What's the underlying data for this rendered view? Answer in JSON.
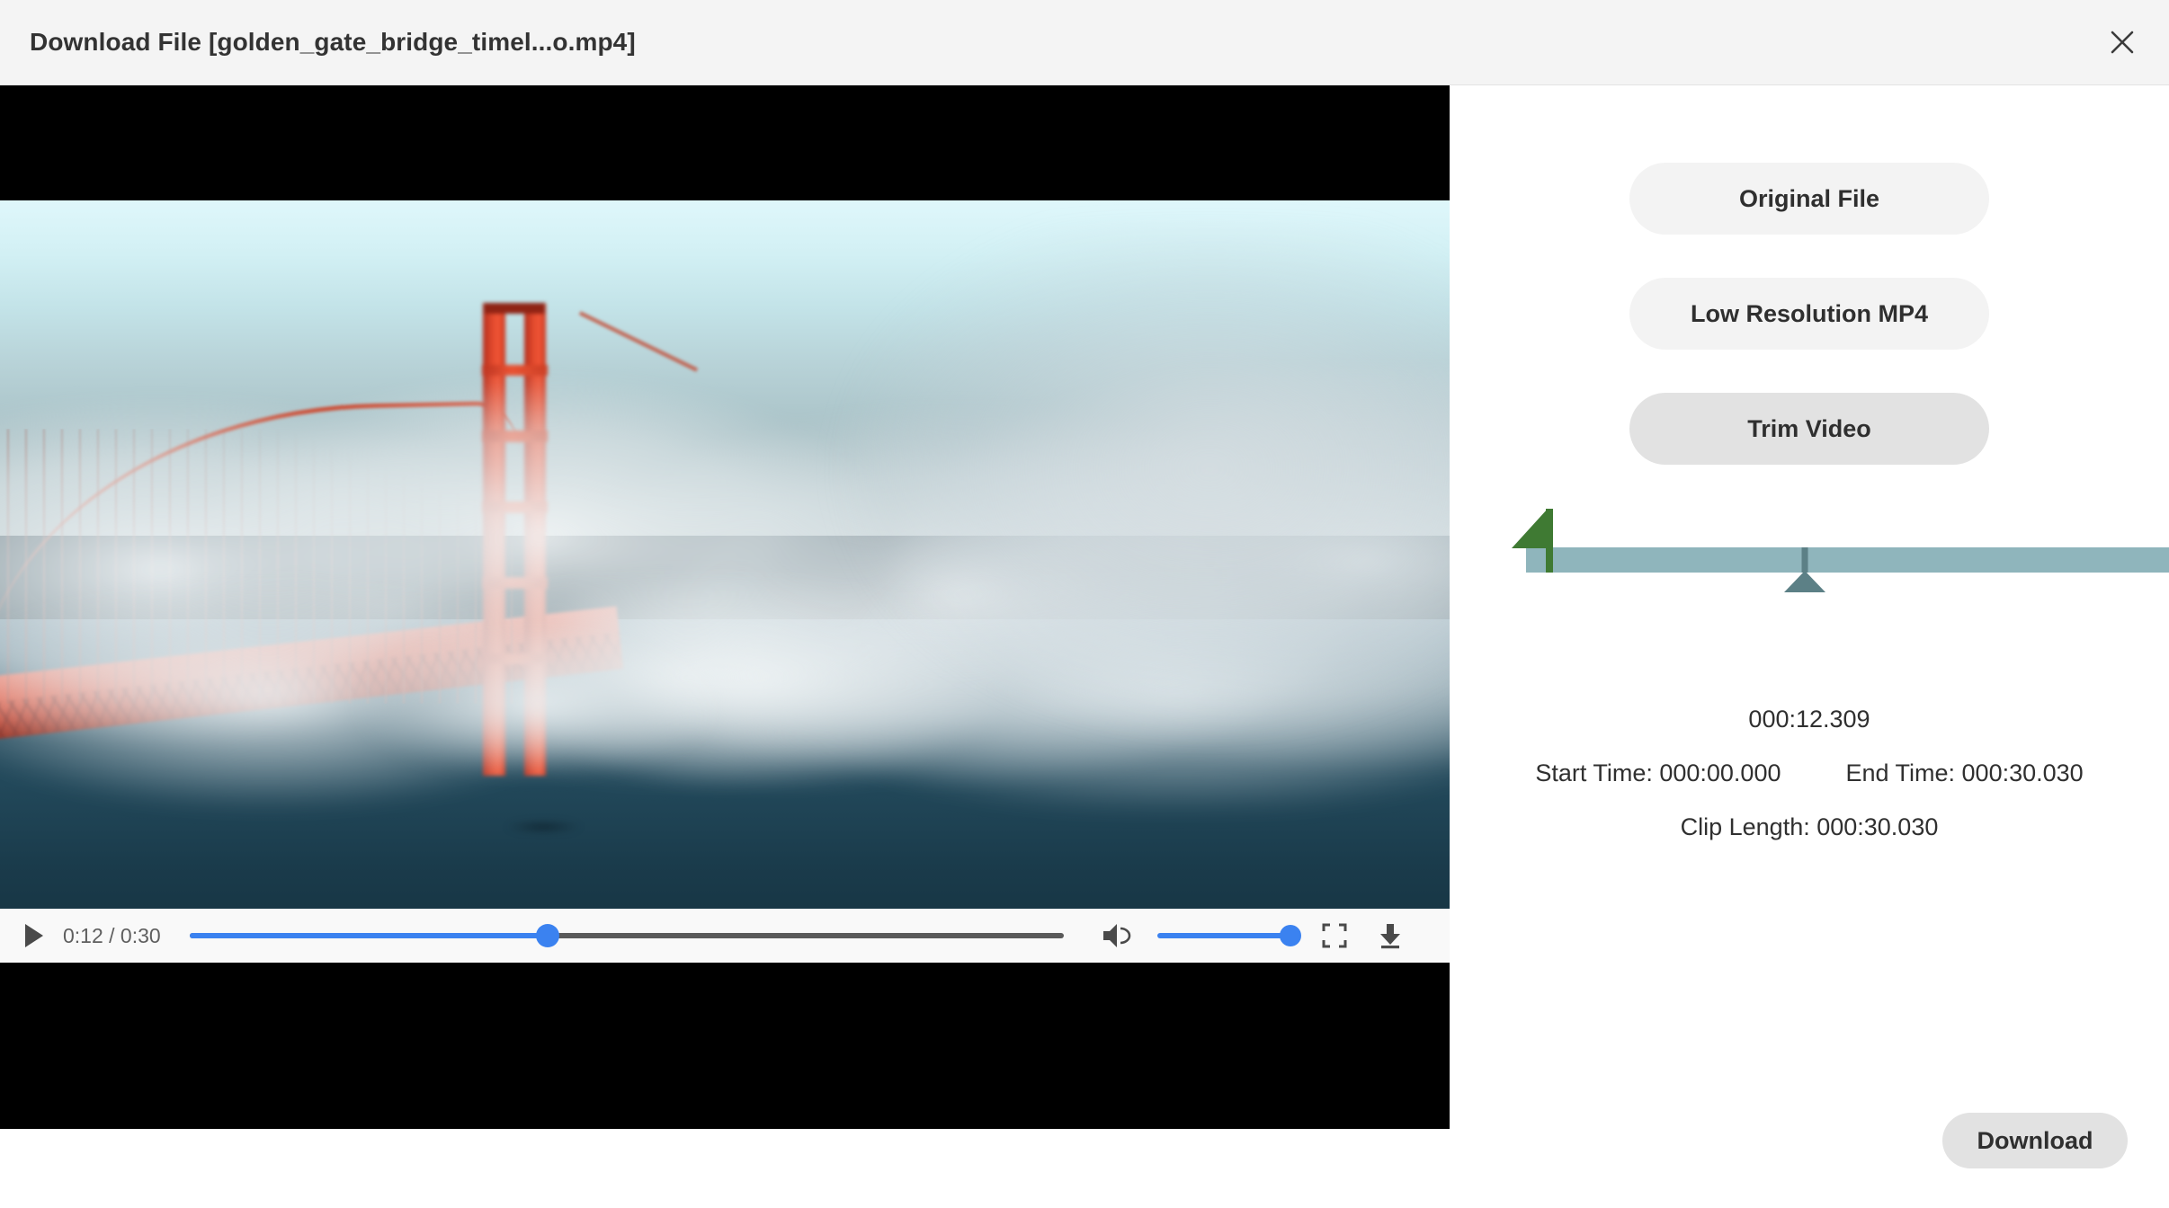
{
  "dialog": {
    "title": "Download File [golden_gate_bridge_timel...o.mp4]",
    "close_label": "×"
  },
  "video": {
    "current_time_label": "0:12",
    "duration_label": "0:30",
    "time_display": "0:12 / 0:30",
    "progress_percent": 41,
    "volume_percent": 100,
    "icons": {
      "play": "play-icon",
      "volume": "volume-icon",
      "fullscreen": "fullscreen-icon",
      "download": "download-icon"
    }
  },
  "options": {
    "original_file": "Original File",
    "low_resolution": "Low Resolution MP4",
    "trim_video": "Trim Video",
    "selected": "Trim Video"
  },
  "trim": {
    "playhead_time": "000:12.309",
    "start_time_label": "Start Time: 000:00.000",
    "end_time_label": "End Time: 000:30.030",
    "clip_length_label": "Clip Length: 000:30.030",
    "start_value": "000:00.000",
    "end_value": "000:30.030",
    "clip_length_value": "000:30.030",
    "playhead_percent": 41,
    "start_handle_percent": 0,
    "end_handle_percent": 100,
    "colors": {
      "track": "#8fb5bc",
      "start_handle": "#3f7a33",
      "end_handle": "#8e1921",
      "playhead": "#5c8086"
    }
  },
  "footer": {
    "download_label": "Download"
  },
  "theme": {
    "titlebar_bg": "#f4f4f4",
    "accent_blue": "#3b82f0",
    "button_bg": "#f3f3f3",
    "button_selected_bg": "#e2e2e2"
  }
}
